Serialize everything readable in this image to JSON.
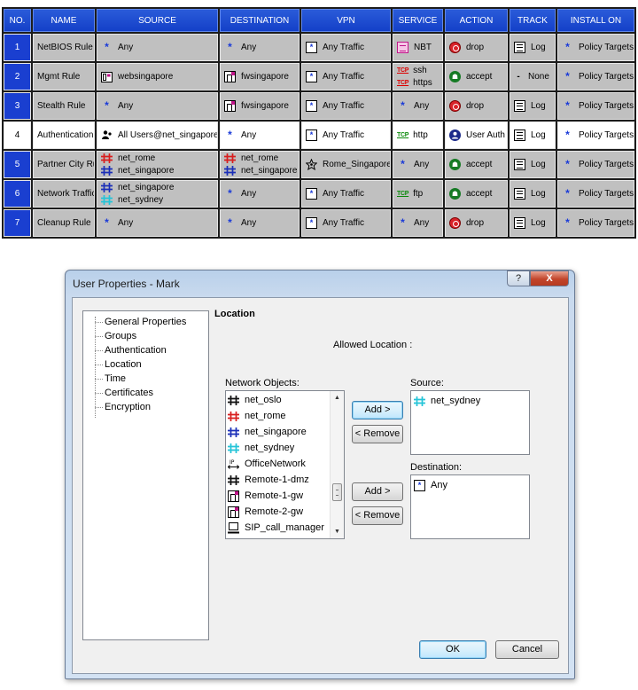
{
  "rule_table": {
    "headers": [
      "NO.",
      "NAME",
      "SOURCE",
      "DESTINATION",
      "VPN",
      "SERVICE",
      "ACTION",
      "TRACK",
      "INSTALL ON"
    ],
    "rows": [
      {
        "no": "1",
        "name": "NetBIOS Rule",
        "source": [
          {
            "icon": "any-icon",
            "text": "Any"
          }
        ],
        "destination": [
          {
            "icon": "any-icon",
            "text": "Any"
          }
        ],
        "vpn": {
          "icon": "any-traffic-icon",
          "text": "Any Traffic"
        },
        "service": [
          {
            "icon": "nbt-icon",
            "text": "NBT"
          }
        ],
        "action": {
          "icon": "drop-icon",
          "text": "drop"
        },
        "track": {
          "icon": "log-icon",
          "text": "Log"
        },
        "install_on": {
          "icon": "any-icon",
          "text": "Policy Targets"
        }
      },
      {
        "no": "2",
        "name": "Mgmt Rule",
        "source": [
          {
            "icon": "host-icon",
            "text": "websingapore"
          }
        ],
        "destination": [
          {
            "icon": "gateway-icon",
            "text": "fwsingapore"
          }
        ],
        "vpn": {
          "icon": "any-traffic-icon",
          "text": "Any Traffic"
        },
        "service": [
          {
            "icon": "tcp-icon",
            "text": "ssh"
          },
          {
            "icon": "tcp-icon",
            "text": "https"
          }
        ],
        "action": {
          "icon": "accept-icon",
          "text": "accept"
        },
        "track": {
          "icon": "none-icon",
          "text": "None"
        },
        "install_on": {
          "icon": "any-icon",
          "text": "Policy Targets"
        }
      },
      {
        "no": "3",
        "name": "Stealth Rule",
        "source": [
          {
            "icon": "any-icon",
            "text": "Any"
          }
        ],
        "destination": [
          {
            "icon": "gateway-icon",
            "text": "fwsingapore"
          }
        ],
        "vpn": {
          "icon": "any-traffic-icon",
          "text": "Any Traffic"
        },
        "service": [
          {
            "icon": "any-icon",
            "text": "Any"
          }
        ],
        "action": {
          "icon": "drop-icon",
          "text": "drop"
        },
        "track": {
          "icon": "log-icon",
          "text": "Log"
        },
        "install_on": {
          "icon": "any-icon",
          "text": "Policy Targets"
        }
      },
      {
        "no": "4",
        "name": "Authentication Rule",
        "source": [
          {
            "icon": "user-group-icon",
            "text": "All Users@net_singapore"
          }
        ],
        "destination": [
          {
            "icon": "any-icon",
            "text": "Any"
          }
        ],
        "vpn": {
          "icon": "any-traffic-icon",
          "text": "Any Traffic"
        },
        "service": [
          {
            "icon": "tcp-green-icon",
            "text": "http"
          }
        ],
        "action": {
          "icon": "user-auth-icon",
          "text": "User Auth"
        },
        "track": {
          "icon": "log-icon",
          "text": "Log"
        },
        "install_on": {
          "icon": "any-icon",
          "text": "Policy Targets"
        }
      },
      {
        "no": "5",
        "name": "Partner City Rule",
        "source": [
          {
            "icon": "network-red-icon",
            "text": "net_rome"
          },
          {
            "icon": "network-blue-icon",
            "text": "net_singapore"
          }
        ],
        "destination": [
          {
            "icon": "network-red-icon",
            "text": "net_rome"
          },
          {
            "icon": "network-blue-icon",
            "text": "net_singapore"
          }
        ],
        "vpn": {
          "icon": "vpn-community-icon",
          "text": "Rome_Singapore"
        },
        "service": [
          {
            "icon": "any-icon",
            "text": "Any"
          }
        ],
        "action": {
          "icon": "accept-icon",
          "text": "accept"
        },
        "track": {
          "icon": "log-icon",
          "text": "Log"
        },
        "install_on": {
          "icon": "any-icon",
          "text": "Policy Targets"
        }
      },
      {
        "no": "6",
        "name": "Network Traffic Rule",
        "source": [
          {
            "icon": "network-blue-icon",
            "text": "net_singapore"
          },
          {
            "icon": "network-cyan-icon",
            "text": "net_sydney"
          }
        ],
        "destination": [
          {
            "icon": "any-icon",
            "text": "Any"
          }
        ],
        "vpn": {
          "icon": "any-traffic-icon",
          "text": "Any Traffic"
        },
        "service": [
          {
            "icon": "tcp-green-icon",
            "text": "ftp"
          }
        ],
        "action": {
          "icon": "accept-icon",
          "text": "accept"
        },
        "track": {
          "icon": "log-icon",
          "text": "Log"
        },
        "install_on": {
          "icon": "any-icon",
          "text": "Policy Targets"
        }
      },
      {
        "no": "7",
        "name": "Cleanup Rule",
        "source": [
          {
            "icon": "any-icon",
            "text": "Any"
          }
        ],
        "destination": [
          {
            "icon": "any-icon",
            "text": "Any"
          }
        ],
        "vpn": {
          "icon": "any-traffic-icon",
          "text": "Any Traffic"
        },
        "service": [
          {
            "icon": "any-icon",
            "text": "Any"
          }
        ],
        "action": {
          "icon": "drop-icon",
          "text": "drop"
        },
        "track": {
          "icon": "log-icon",
          "text": "Log"
        },
        "install_on": {
          "icon": "any-icon",
          "text": "Policy Targets"
        }
      }
    ],
    "highlighted_row": "4",
    "tcp_badge": "TCP"
  },
  "dialog": {
    "title": "User Properties - Mark",
    "help_label": "?",
    "close_label": "X",
    "tree_items": [
      "General Properties",
      "Groups",
      "Authentication",
      "Location",
      "Time",
      "Certificates",
      "Encryption"
    ],
    "section_title": "Location",
    "allowed_location_label": "Allowed Location :",
    "network_objects_label": "Network Objects:",
    "network_objects": [
      {
        "icon": "network-black-icon",
        "text": "net_oslo"
      },
      {
        "icon": "network-red-icon",
        "text": "net_rome"
      },
      {
        "icon": "network-blue-icon",
        "text": "net_singapore"
      },
      {
        "icon": "network-cyan-icon",
        "text": "net_sydney"
      },
      {
        "icon": "ip-range-icon",
        "text": "OfficeNetwork"
      },
      {
        "icon": "network-black-icon",
        "text": "Remote-1-dmz"
      },
      {
        "icon": "gateway-icon",
        "text": "Remote-1-gw"
      },
      {
        "icon": "gateway-icon",
        "text": "Remote-2-gw"
      },
      {
        "icon": "computer-icon",
        "text": "SIP_call_manager"
      }
    ],
    "add_label": "Add >",
    "remove_label": "< Remove",
    "source_label": "Source:",
    "source_items": [
      {
        "icon": "network-cyan-icon",
        "text": "net_sydney"
      }
    ],
    "destination_label": "Destination:",
    "destination_items": [
      {
        "icon": "any-icon",
        "text": "Any"
      }
    ],
    "ok_label": "OK",
    "cancel_label": "Cancel"
  },
  "colors": {
    "header_blue": "#1440c8",
    "row_gray": "#c0c0c0",
    "drop_red": "#d9232a",
    "accept_green": "#157a24",
    "any_blue": "#1a3ad8",
    "net_red": "#d81e1e",
    "net_blue": "#1b2fb8",
    "net_cyan": "#24c4d8"
  }
}
